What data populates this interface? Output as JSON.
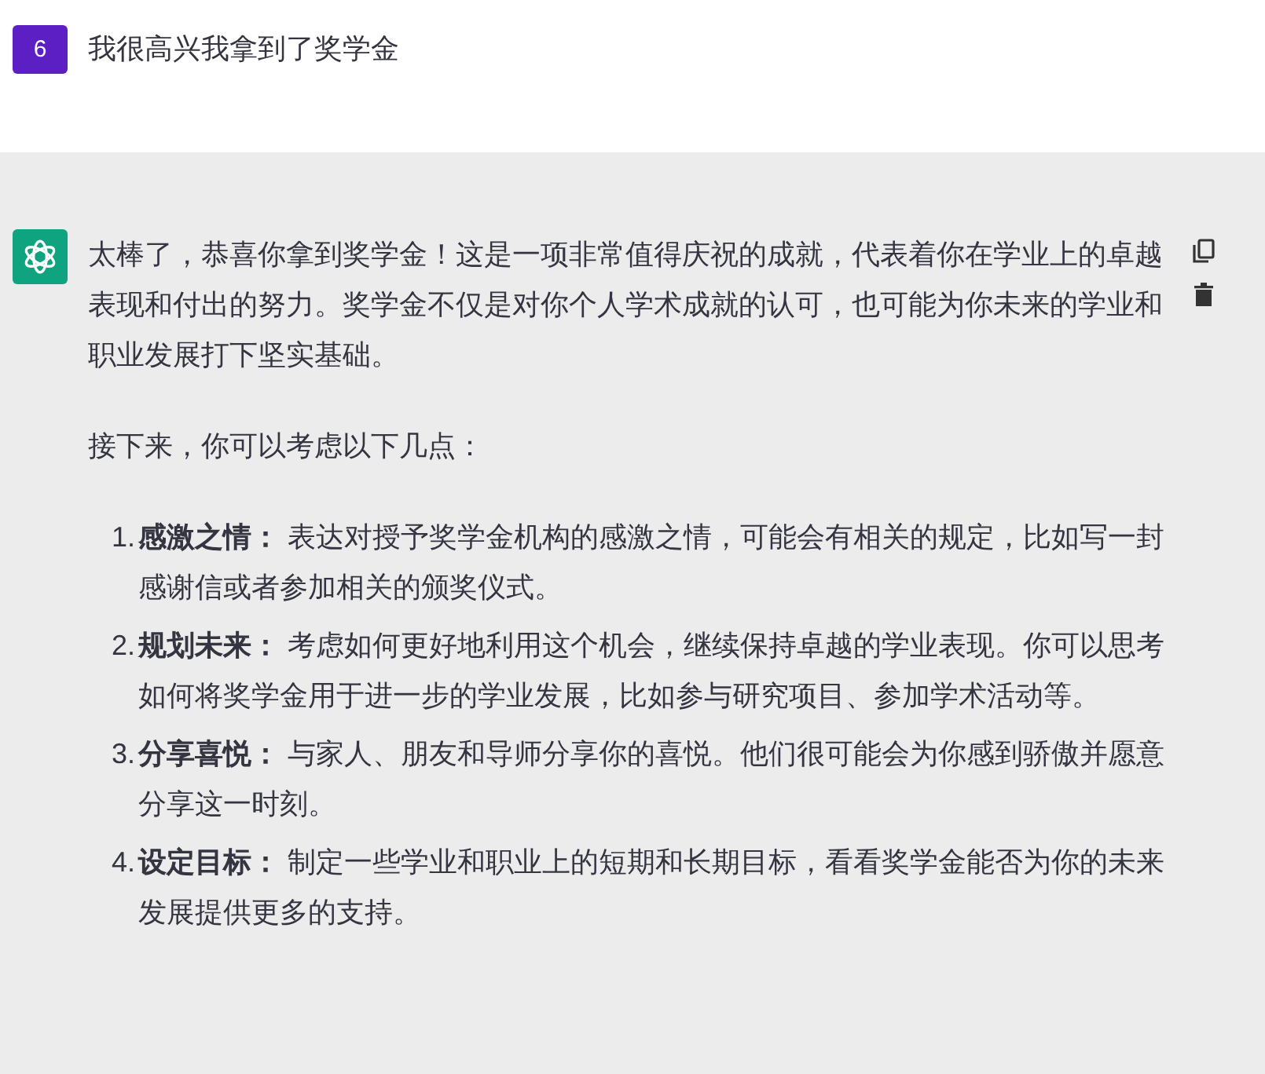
{
  "user_message": {
    "avatar": "6",
    "text": "我很高兴我拿到了奖学金"
  },
  "assistant_message": {
    "paragraphs": [
      "太棒了，恭喜你拿到奖学金！这是一项非常值得庆祝的成就，代表着你在学业上的卓越表现和付出的努力。奖学金不仅是对你个人学术成就的认可，也可能为你未来的学业和职业发展打下坚实基础。",
      "接下来，你可以考虑以下几点："
    ],
    "list": [
      {
        "number": "1.",
        "text": "**感激之情：** 表达对授予奖学金机构的感激之情，可能会有相关的规定，比如写一封感谢信或者参加相关的颁奖仪式。"
      },
      {
        "number": "2.",
        "text": "**规划未来：** 考虑如何更好地利用这个机会，继续保持卓越的学业表现。你可以思考如何将奖学金用于进一步的学业发展，比如参与研究项目、参加学术活动等。"
      },
      {
        "number": "3.",
        "text": "**分享喜悦：** 与家人、朋友和导师分享你的喜悦。他们很可能会为你感到骄傲并愿意分享这一时刻。"
      },
      {
        "number": "4.",
        "text": "**设定目标：** 制定一些学业和职业上的短期和长期目标，看看奖学金能否为你的未来发展提供更多的支持。"
      }
    ]
  }
}
